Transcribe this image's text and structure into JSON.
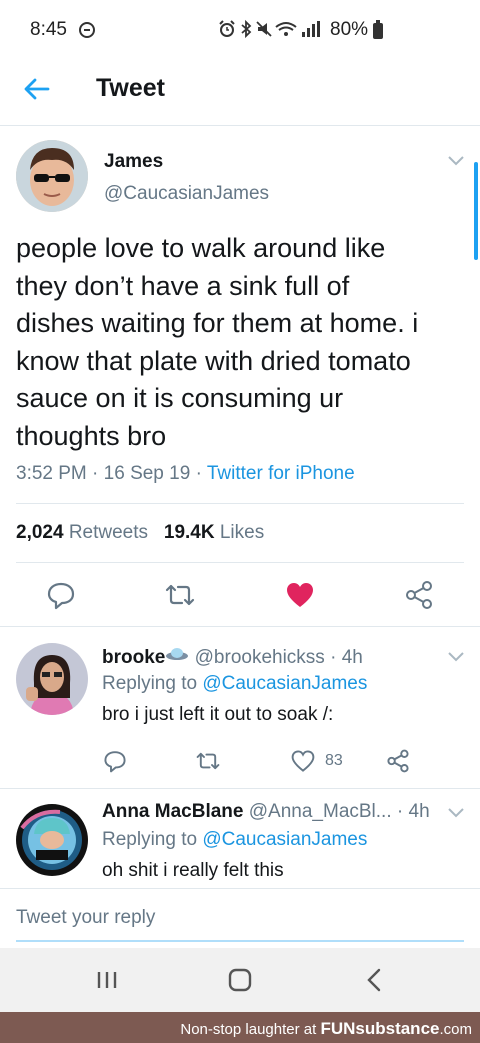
{
  "status_bar": {
    "time": "8:45",
    "battery": "80%",
    "icons": [
      "alarm-icon",
      "bluetooth-icon",
      "mute-icon",
      "wifi-icon",
      "signal-icon",
      "battery-icon"
    ]
  },
  "header": {
    "title": "Tweet"
  },
  "tweet": {
    "author_name": "James",
    "author_handle": "@CaucasianJames",
    "text": "people love to walk around like\nthey don’t have a sink full of\ndishes waiting for them at home. i\nknow that plate with dried tomato\nsauce on it is consuming ur\nthoughts bro",
    "time": "3:52 PM",
    "date": "16 Sep 19",
    "source": "Twitter for iPhone",
    "sep": "·",
    "retweet_count": "2,024",
    "retweet_label": "Retweets",
    "like_count": "19.4K",
    "like_label": "Likes",
    "liked": true
  },
  "replies": [
    {
      "name": "brooke",
      "handle": "@brookehickss",
      "age": "· 4h",
      "replying_label": "Replying to",
      "replying_to": "@CaucasianJames",
      "text": "bro i just left it out to soak /:",
      "like_count": "83"
    },
    {
      "name": "Anna MacBlane",
      "handle": "@Anna_MacBl...",
      "age": "· 4h",
      "replying_label": "Replying to",
      "replying_to": "@CaucasianJames",
      "text": "oh shit i really felt this"
    }
  ],
  "compose": {
    "placeholder": "Tweet your reply"
  },
  "watermark": {
    "text": "Non-stop laughter at",
    "brand": "FUNsubstance",
    "suffix": ".com"
  },
  "colors": {
    "accent": "#1da1f2",
    "like": "#e0245e",
    "muted": "#657786",
    "text": "#14171a"
  }
}
